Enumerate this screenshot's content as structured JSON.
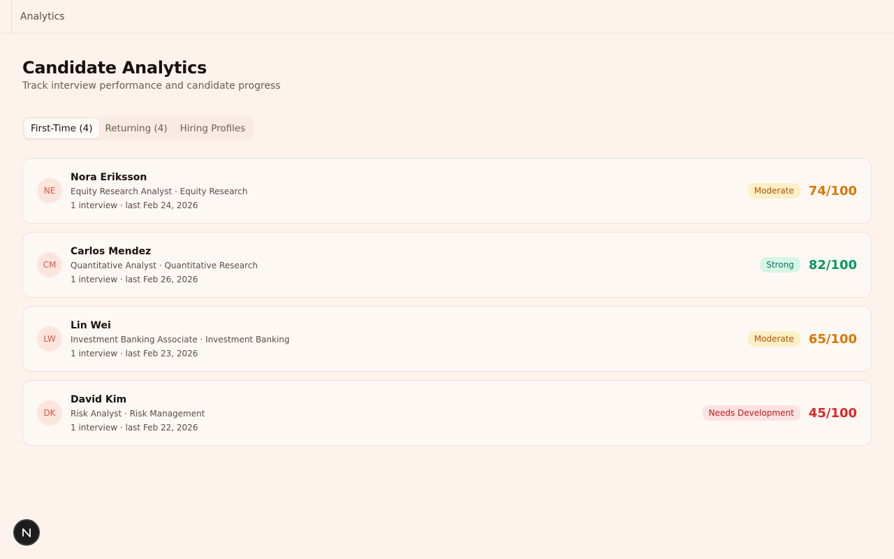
{
  "header": {
    "breadcrumb": "Analytics"
  },
  "page": {
    "title": "Candidate Analytics",
    "subtitle": "Track interview performance and candidate progress"
  },
  "tabs": [
    {
      "label": "First-Time (4)",
      "active": true
    },
    {
      "label": "Returning (4)",
      "active": false
    },
    {
      "label": "Hiring Profiles",
      "active": false
    }
  ],
  "candidates": [
    {
      "initials": "NE",
      "name": "Nora Eriksson",
      "role": "Equity Research Analyst · Equity Research",
      "meta": "1 interview · last Feb 24, 2026",
      "badge": "Moderate",
      "score": "74/100",
      "badge_bg": "#fdefc6",
      "badge_color": "#b45309",
      "score_color": "#d97706"
    },
    {
      "initials": "CM",
      "name": "Carlos Mendez",
      "role": "Quantitative Analyst · Quantitative Research",
      "meta": "1 interview · last Feb 26, 2026",
      "badge": "Strong",
      "score": "82/100",
      "badge_bg": "#d7f5e6",
      "badge_color": "#047857",
      "score_color": "#059669"
    },
    {
      "initials": "LW",
      "name": "Lin Wei",
      "role": "Investment Banking Associate · Investment Banking",
      "meta": "1 interview · last Feb 23, 2026",
      "badge": "Moderate",
      "score": "65/100",
      "badge_bg": "#fdefc6",
      "badge_color": "#b45309",
      "score_color": "#d97706"
    },
    {
      "initials": "DK",
      "name": "David Kim",
      "role": "Risk Analyst · Risk Management",
      "meta": "1 interview · last Feb 22, 2026",
      "badge": "Needs Development",
      "score": "45/100",
      "badge_bg": "#fde2e2",
      "badge_color": "#b91c1c",
      "score_color": "#dc2626"
    }
  ],
  "fab": {
    "icon": "n-logo-icon",
    "letter": "N"
  }
}
